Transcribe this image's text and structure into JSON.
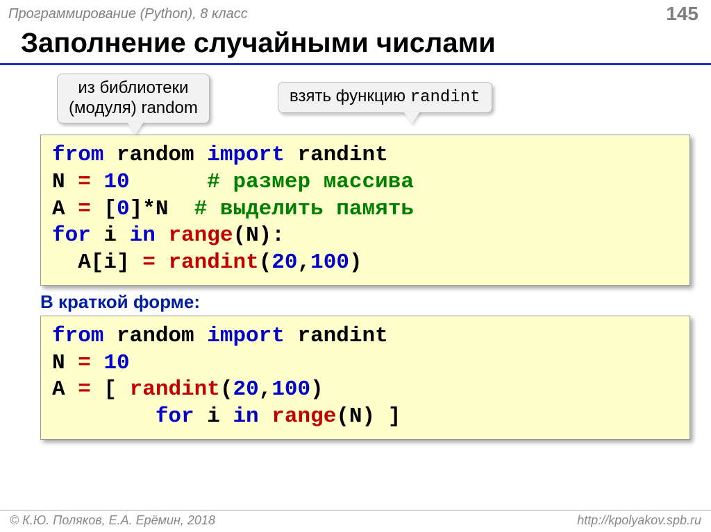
{
  "header": {
    "course": "Программирование (Python), 8 класс",
    "page": "145"
  },
  "title": "Заполнение случайными числами",
  "callouts": {
    "left_line1": "из библиотеки",
    "left_line2": "(модуля) random",
    "right_prefix": "взять функцию ",
    "right_mono": "randint"
  },
  "code1": {
    "l1_kw1": "from",
    "l1_t1": " random ",
    "l1_kw2": "import",
    "l1_t2": " randint",
    "l2_a": "N ",
    "l2_eq": "=",
    "l2_b": " ",
    "l2_num": "10",
    "l2_pad": "      ",
    "l2_cmt": "# размер массива",
    "l3_a": "A ",
    "l3_eq": "=",
    "l3_b": " [",
    "l3_num": "0",
    "l3_c": "]*N  ",
    "l3_cmt": "# выделить память",
    "l4_kw1": "for",
    "l4_a": " i ",
    "l4_kw2": "in",
    "l4_b": " ",
    "l4_call": "range",
    "l4_c": "(N):",
    "l5_a": "  A[i] ",
    "l5_eq": "=",
    "l5_b": " ",
    "l5_call": "randint",
    "l5_c": "(",
    "l5_n1": "20",
    "l5_d": ",",
    "l5_n2": "100",
    "l5_e": ")"
  },
  "subhead": "В краткой форме:",
  "code2": {
    "l1_kw1": "from",
    "l1_t1": " random ",
    "l1_kw2": "import",
    "l1_t2": " randint",
    "l2_a": "N ",
    "l2_eq": "=",
    "l2_b": " ",
    "l2_num": "10",
    "l3_a": "A ",
    "l3_eq": "=",
    "l3_b": " [ ",
    "l3_call": "randint",
    "l3_c": "(",
    "l3_n1": "20",
    "l3_d": ",",
    "l3_n2": "100",
    "l3_e": ")",
    "l4_pad": "        ",
    "l4_kw1": "for",
    "l4_a": " i ",
    "l4_kw2": "in",
    "l4_b": " ",
    "l4_call": "range",
    "l4_c": "(N) ]"
  },
  "footer": {
    "left": "© К.Ю. Поляков, Е.А. Ерёмин, 2018",
    "right": "http://kpolyakov.spb.ru"
  }
}
